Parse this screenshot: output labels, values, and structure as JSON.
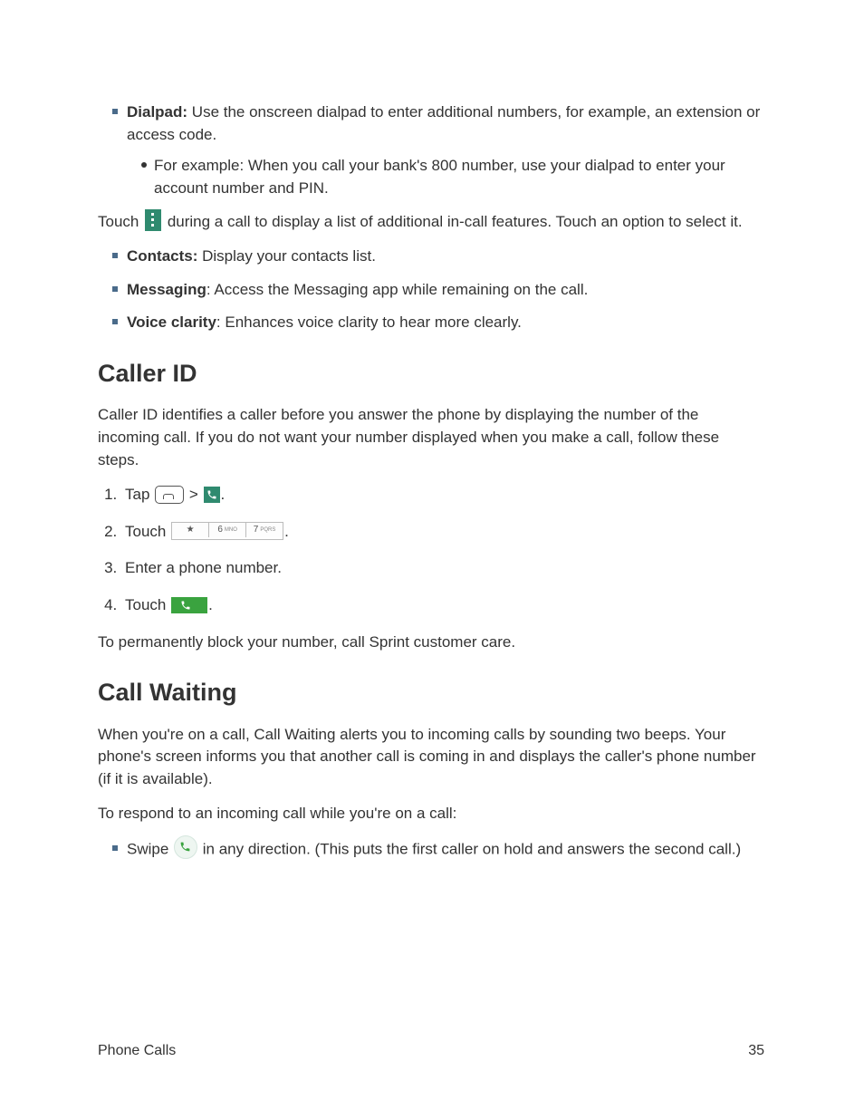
{
  "top_list": {
    "dialpad_label": "Dialpad:",
    "dialpad_text": " Use the onscreen dialpad to enter additional numbers, for example, an extension or access code.",
    "dialpad_example": "For example: When you call your bank's 800 number, use your dialpad to enter your account number and PIN."
  },
  "touch_line": {
    "before": "Touch ",
    "after": " during a call to display a list of additional in-call features. Touch an option to select it."
  },
  "feature_list": {
    "contacts_label": "Contacts:",
    "contacts_text": " Display your contacts list.",
    "messaging_label": "Messaging",
    "messaging_text": ": Access the Messaging app while remaining on the call.",
    "voice_label": "Voice clarity",
    "voice_text": ": Enhances voice clarity to hear more clearly."
  },
  "caller_id": {
    "heading": "Caller ID",
    "intro": "Caller ID identifies a caller before you answer the phone by displaying the number of the incoming call. If you do not want your number displayed when you make a call, follow these steps.",
    "step1_before": "Tap ",
    "step1_sep": " > ",
    "step1_after": ".",
    "step2_before": "Touch ",
    "step2_after": ".",
    "step3": "Enter a phone number.",
    "step4_before": "Touch ",
    "step4_after": ".",
    "outro": "To permanently block your number, call Sprint customer care."
  },
  "dialkeys": {
    "k1": "★",
    "k2": "6",
    "k2_sub": "MNO",
    "k3": "7",
    "k3_sub": "PQRS"
  },
  "call_waiting": {
    "heading": "Call Waiting",
    "intro": "When you're on a call, Call Waiting alerts you to incoming calls by sounding two beeps. Your phone's screen informs you that another call is coming in and displays the caller's phone number (if it is available).",
    "respond": "To respond to an incoming call while you're on a call:",
    "swipe_before": "Swipe ",
    "swipe_after": " in any direction. (This puts the first caller on hold and answers the second call.)"
  },
  "footer": {
    "section": "Phone Calls",
    "page": "35"
  }
}
